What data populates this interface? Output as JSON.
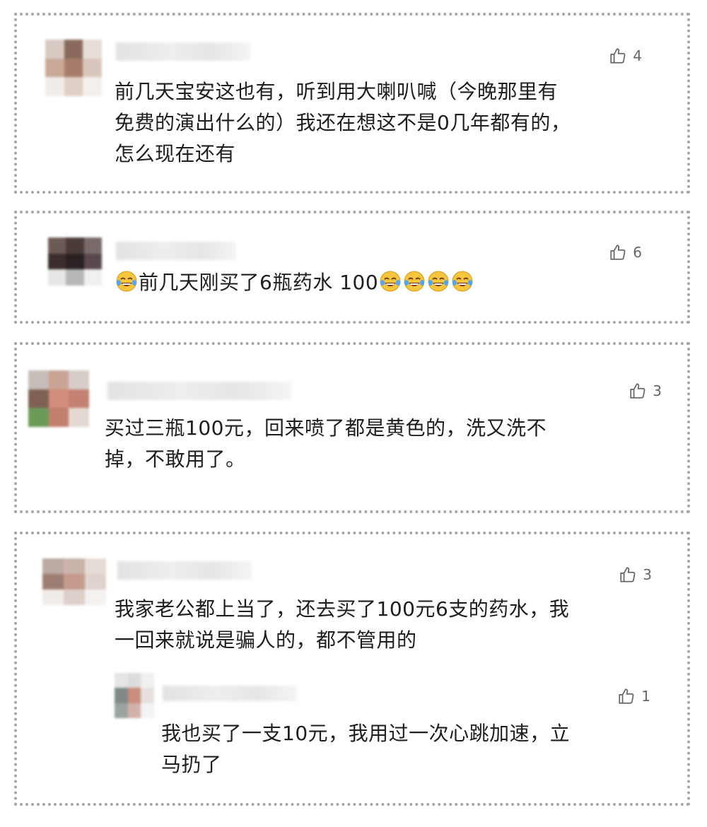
{
  "comments": [
    {
      "likes": "4",
      "text_lines": [
        "前几天宝安这也有，听到用大喇叭喊（今晚那里有",
        "免费的演出什么的）我还在想这不是0几年都有的，",
        "怎么现在还有"
      ]
    },
    {
      "likes": "6",
      "text": "前几天刚买了6瓶药水 100",
      "emoji_icon": "laughing-tears-emoji"
    },
    {
      "likes": "3",
      "text_lines": [
        "买过三瓶100元，回来喷了都是黄色的，洗又洗不",
        "掉，不敢用了。"
      ]
    },
    {
      "likes": "3",
      "text_lines": [
        "我家老公都上当了，还去买了100元6支的药水，我",
        "一回来就说是骗人的，都不管用的"
      ]
    },
    {
      "likes": "1",
      "text_lines": [
        "我也买了一支10元，我用过一次心跳加速，立",
        "马扔了"
      ]
    }
  ],
  "colors": {
    "border": "#a8a8a8",
    "text": "#1e1e1e",
    "like": "#666666"
  }
}
